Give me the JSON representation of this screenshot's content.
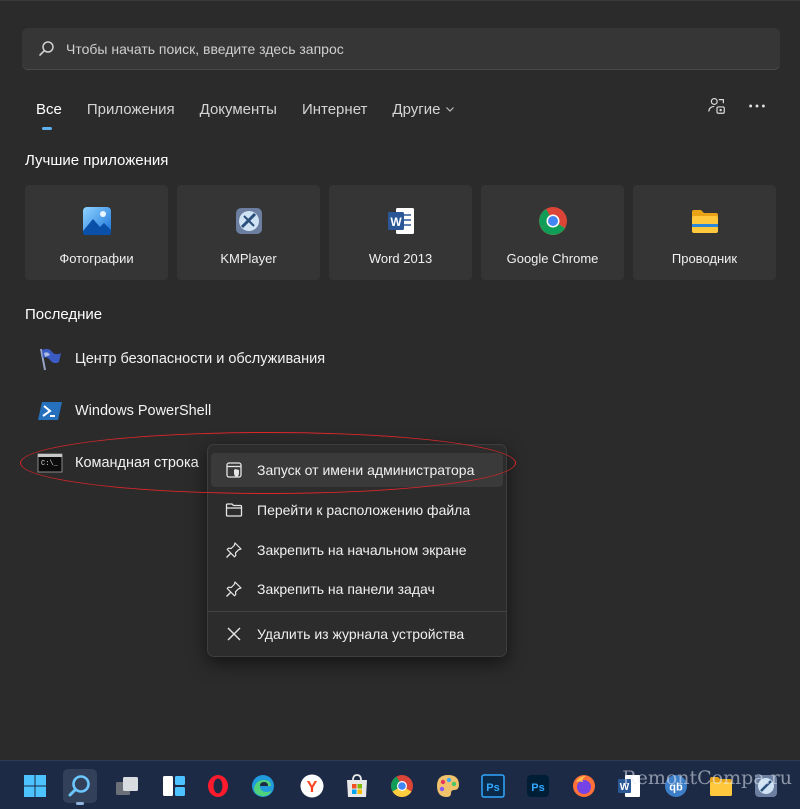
{
  "search": {
    "placeholder": "Чтобы начать поиск, введите здесь запрос",
    "icon": "search-icon"
  },
  "tabs": [
    {
      "label": "Все",
      "active": true
    },
    {
      "label": "Приложения"
    },
    {
      "label": "Документы"
    },
    {
      "label": "Интернет"
    },
    {
      "label": "Другие"
    }
  ],
  "top_icons": [
    "share-account-icon",
    "more-icon"
  ],
  "top_apps_title": "Лучшие приложения",
  "top_apps": [
    {
      "label": "Фотографии",
      "icon": "photos-icon"
    },
    {
      "label": "KMPlayer",
      "icon": "kmplayer-icon"
    },
    {
      "label": "Word 2013",
      "icon": "word-icon"
    },
    {
      "label": "Google Chrome",
      "icon": "chrome-icon"
    },
    {
      "label": "Проводник",
      "icon": "explorer-icon"
    }
  ],
  "recent_title": "Последние",
  "recent": [
    {
      "label": "Центр безопасности и обслуживания",
      "icon": "flag-icon"
    },
    {
      "label": "Windows PowerShell",
      "icon": "powershell-icon"
    },
    {
      "label": "Командная строка",
      "icon": "cmd-icon"
    }
  ],
  "context_menu": [
    {
      "label": "Запуск от имени администратора",
      "icon": "admin-shield-icon",
      "highlighted": true
    },
    {
      "label": "Перейти к расположению файла",
      "icon": "folder-icon"
    },
    {
      "label": "Закрепить на начальном экране",
      "icon": "pin-icon"
    },
    {
      "label": "Закрепить на панели задач",
      "icon": "pin-icon"
    },
    {
      "label": "Удалить из журнала устройства",
      "icon": "close-icon"
    }
  ],
  "taskbar": [
    "start-icon",
    "search-icon",
    "task-view-icon",
    "widgets-icon",
    "opera-icon",
    "edge-icon",
    "yandex-icon",
    "store-icon",
    "chrome-icon",
    "paint-icon",
    "photoshop-icon",
    "photoshop-icon",
    "firefox-icon",
    "word-icon",
    "qbittorrent-icon",
    "explorer-icon",
    "kmplayer-icon"
  ],
  "watermark": "RemontCompa.ru",
  "colors": {
    "accent": "#5fb2f2",
    "annotation": "#d8262b",
    "taskbar": "#1d2a45"
  }
}
